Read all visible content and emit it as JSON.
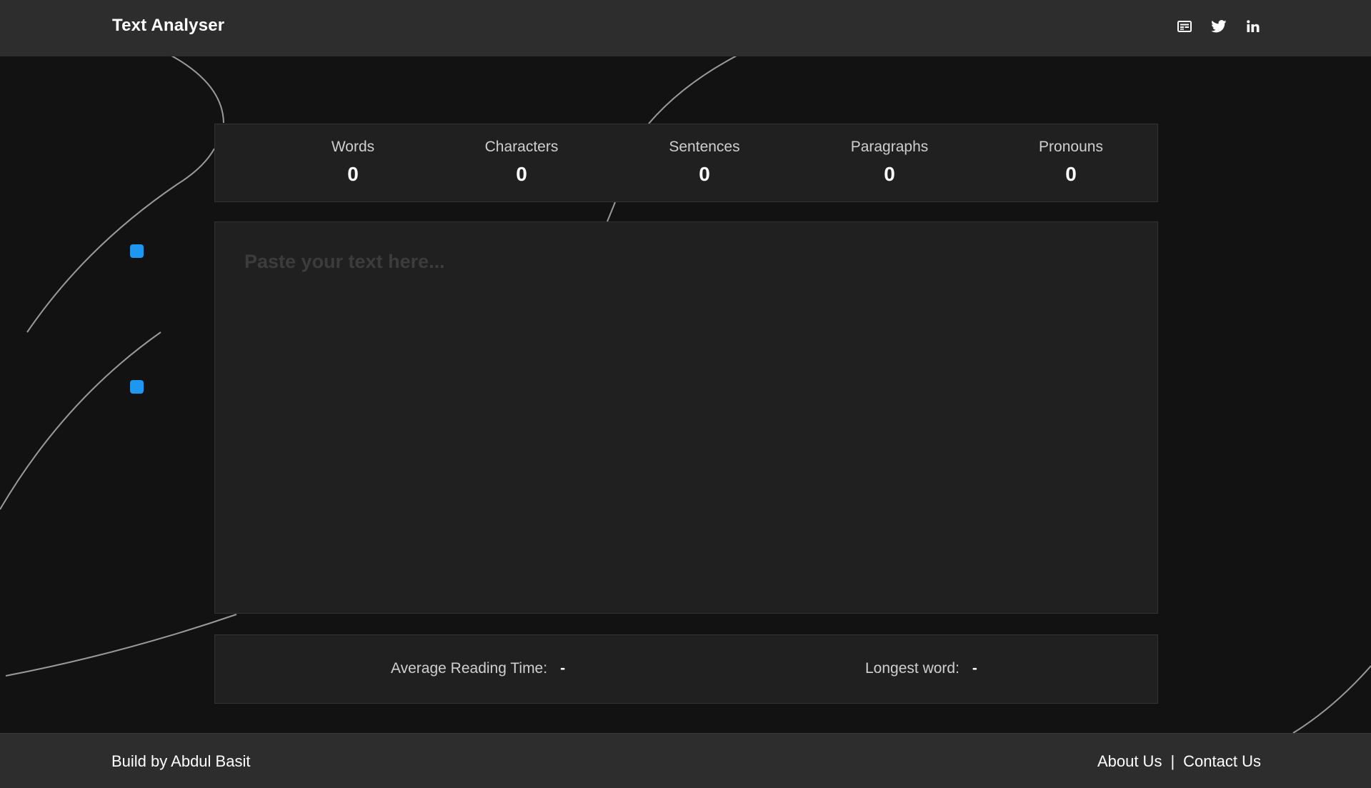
{
  "header": {
    "title": "Text Analyser",
    "social_icons": [
      "blog-icon",
      "twitter-icon",
      "linkedin-icon"
    ]
  },
  "stats": [
    {
      "label": "Words",
      "value": "0"
    },
    {
      "label": "Characters",
      "value": "0"
    },
    {
      "label": "Sentences",
      "value": "0"
    },
    {
      "label": "Paragraphs",
      "value": "0"
    },
    {
      "label": "Pronouns",
      "value": "0"
    }
  ],
  "editor": {
    "placeholder": "Paste your text here...",
    "value": ""
  },
  "info": {
    "reading_time_label": "Average Reading Time:",
    "reading_time_value": "-",
    "longest_word_label": "Longest word:",
    "longest_word_value": "-"
  },
  "footer": {
    "credit": "Build by Abdul Basit",
    "about_label": "About Us",
    "separator": "|",
    "contact_label": "Contact Us"
  },
  "colors": {
    "background": "#121212",
    "header": "#2d2d2d",
    "panel": "#202020",
    "accent": "#1e97f1"
  }
}
